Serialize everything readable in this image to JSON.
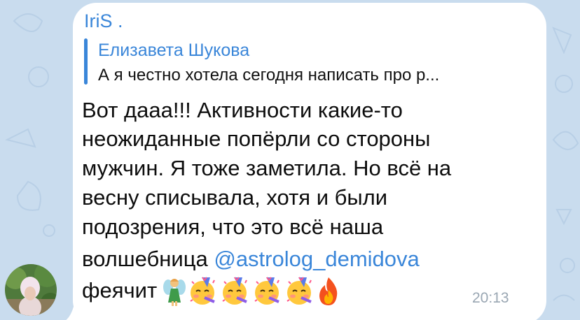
{
  "message": {
    "sender": "IriS .",
    "reply": {
      "author": "Елизавета Шукова",
      "text": "А я честно хотела сегодня написать про р..."
    },
    "lines": [
      "Вот дааа!!! Активности какие-то",
      "неожиданные попёрли со стороны",
      "мужчин. Я тоже заметила. Но всё на",
      "весну списывала, хотя и были",
      "подозрения, что это всё наша"
    ],
    "line6_prefix": "волшебница ",
    "mention": "@astrolog_demidova",
    "last_word": "феячит",
    "emojis": [
      "fairy-emoji",
      "partying-face-emoji",
      "partying-face-emoji",
      "partying-face-emoji",
      "partying-face-emoji",
      "fire-emoji"
    ],
    "time": "20:13"
  },
  "colors": {
    "accent": "#3a86d9",
    "bubble": "#ffffff",
    "wallpaper": "#c9dcee",
    "time": "#9aa7b3"
  }
}
